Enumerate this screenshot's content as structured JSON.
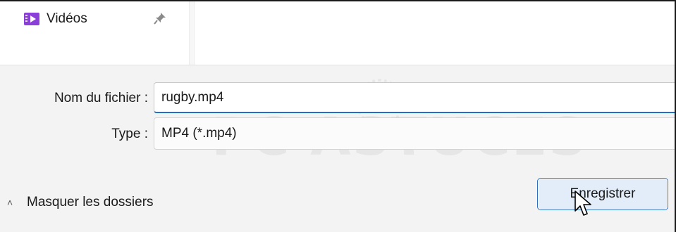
{
  "nav": {
    "items": [
      {
        "label": "Vidéos",
        "icon": "video-folder-icon",
        "pinned": true
      }
    ]
  },
  "form": {
    "filename_label": "Nom du fichier :",
    "filename_value": "rugby.mp4",
    "type_label": "Type :",
    "type_value": "MP4 (*.mp4)"
  },
  "footer": {
    "toggle_folders_label": "Masquer les dossiers",
    "save_label": "Enregistrer"
  },
  "watermark": {
    "text": "PC ASTUCES"
  },
  "colors": {
    "accent": "#1f6fcc",
    "video_icon": "#8b3fd9",
    "button_bg": "#e3edf9"
  }
}
